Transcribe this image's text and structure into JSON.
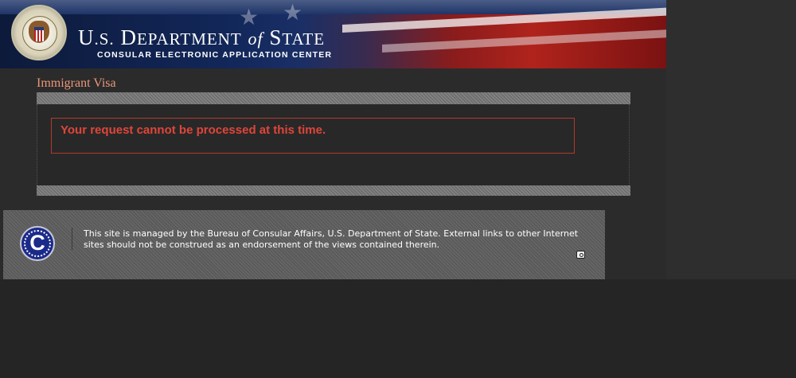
{
  "header": {
    "title": "U.S. Department of State",
    "subtitle": "CONSULAR ELECTRONIC APPLICATION CENTER"
  },
  "page": {
    "section_title": "Immigrant Visa",
    "error_message": "Your request cannot be processed at this time."
  },
  "footer": {
    "notice": "This site is managed by the Bureau of Consular Affairs, U.S. Department of State. External links to other Internet sites should not be construed as an endorsement of the views contained therein.",
    "logo_letter": "C"
  },
  "colors": {
    "background": "#252525",
    "section_title": "#e9967a",
    "error_text": "#e0453a",
    "error_border": "#b33a2b"
  }
}
